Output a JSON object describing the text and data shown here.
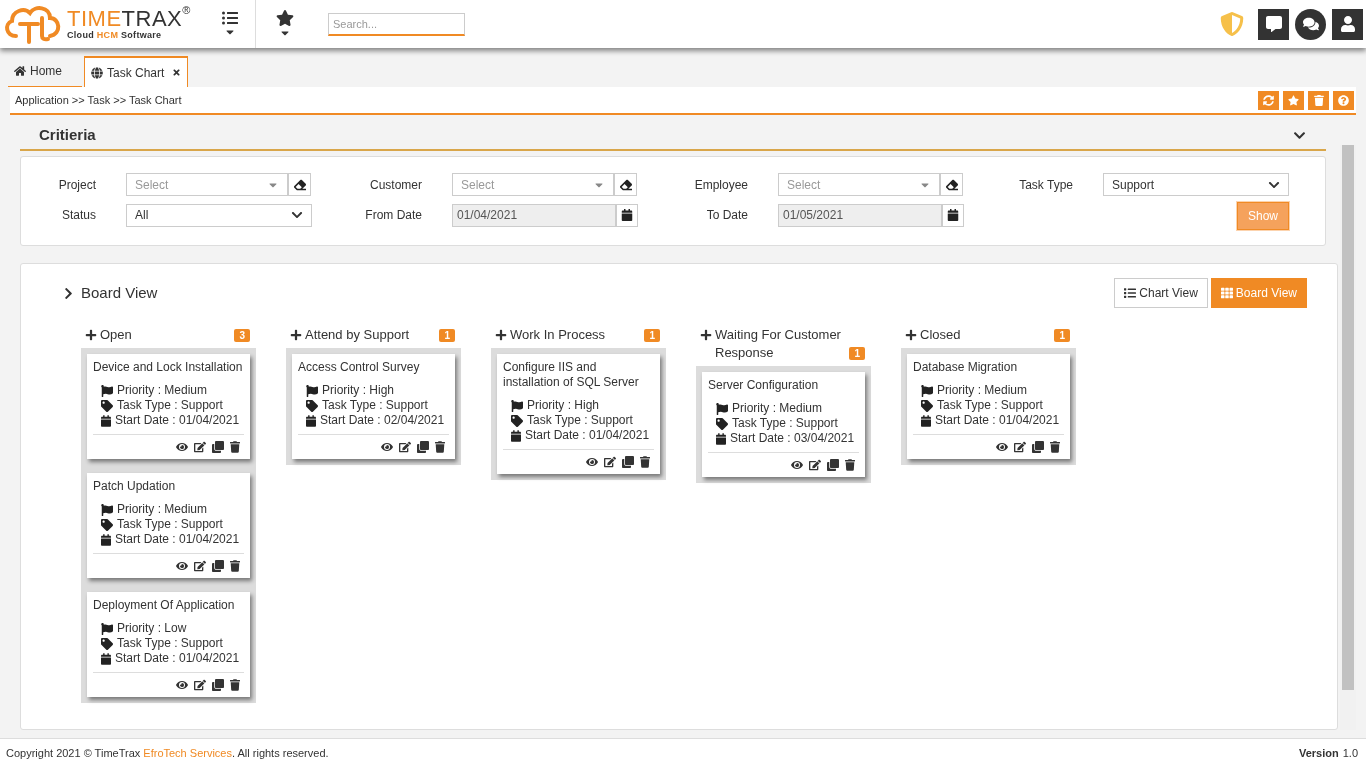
{
  "header": {
    "logo": {
      "brand_light": "TIME",
      "brand_dark": "TRAX",
      "registered": "®",
      "tagline_start": "Cloud ",
      "tagline_accent": "HCM",
      "tagline_end": " Software"
    },
    "search": {
      "placeholder": "Search..."
    }
  },
  "tabs": [
    {
      "label": "Home",
      "kind": "home",
      "selected": false,
      "closable": false
    },
    {
      "label": "Task Chart",
      "kind": "globe",
      "selected": true,
      "closable": true
    }
  ],
  "breadcrumb": "Application >> Task >> Task Chart",
  "criteria": {
    "title": "Critieria",
    "expanded": true,
    "fields": [
      {
        "label": "Project",
        "kind": "combo",
        "placeholder": "Select"
      },
      {
        "label": "Customer",
        "kind": "combo",
        "placeholder": "Select"
      },
      {
        "label": "Employee",
        "kind": "combo",
        "placeholder": "Select"
      },
      {
        "label": "Task Type",
        "kind": "dropdown",
        "value": "Support"
      },
      {
        "label": "Status",
        "kind": "dropdown",
        "value": "All"
      },
      {
        "label": "From Date",
        "kind": "date",
        "value": "01/04/2021"
      },
      {
        "label": "To Date",
        "kind": "date",
        "value": "01/05/2021"
      }
    ],
    "show_button": "Show"
  },
  "board": {
    "title": "Board View",
    "expanded": false,
    "view_buttons": [
      {
        "label": "Chart View",
        "kind": "list",
        "selected": false
      },
      {
        "label": "Board View",
        "kind": "grid",
        "selected": true
      }
    ],
    "columns": [
      {
        "title": "Open",
        "count": "3",
        "cards": [
          {
            "title": "Device and Lock Installation",
            "priority": "Priority : Medium",
            "task_type": "Task Type : Support",
            "start_date": "Start Date : 01/04/2021"
          },
          {
            "title": "Patch Updation",
            "priority": "Priority : Medium",
            "task_type": "Task Type : Support",
            "start_date": "Start Date : 01/04/2021"
          },
          {
            "title": "Deployment Of Application",
            "priority": "Priority : Low",
            "task_type": "Task Type : Support",
            "start_date": "Start Date : 01/04/2021"
          }
        ]
      },
      {
        "title": "Attend by Support",
        "count": "1",
        "cards": [
          {
            "title": "Access Control Survey",
            "priority": "Priority : High",
            "task_type": "Task Type : Support",
            "start_date": "Start Date : 02/04/2021"
          }
        ]
      },
      {
        "title": "Work In Process",
        "count": "1",
        "cards": [
          {
            "title": "Configure IIS and installation of SQL Server",
            "priority": "Priority : High",
            "task_type": "Task Type : Support",
            "start_date": "Start Date : 01/04/2021"
          }
        ]
      },
      {
        "title": "Waiting For Customer Response",
        "count": "1",
        "cards": [
          {
            "title": "Server Configuration",
            "priority": "Priority : Medium",
            "task_type": "Task Type : Support",
            "start_date": "Start Date : 03/04/2021"
          }
        ]
      },
      {
        "title": "Closed",
        "count": "1",
        "cards": [
          {
            "title": "Database Migration",
            "priority": "Priority : Medium",
            "task_type": "Task Type : Support",
            "start_date": "Start Date : 01/04/2021"
          }
        ]
      }
    ]
  },
  "footer": {
    "copyright": "Copyright 2021 © TimeTrax",
    "company": "EfroTech Services",
    "rights": ". All rights reserved.",
    "version_label": "Version",
    "version": "1.0"
  }
}
